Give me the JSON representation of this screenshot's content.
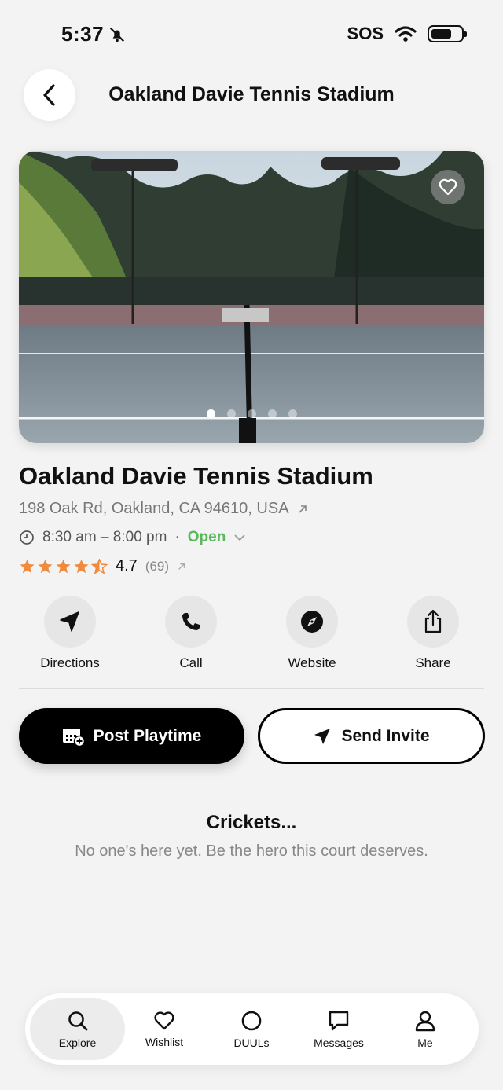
{
  "status_bar": {
    "time": "5:37",
    "carrier": "SOS"
  },
  "header": {
    "title": "Oakland Davie Tennis Stadium"
  },
  "gallery": {
    "page_count": 5,
    "active_index": 0
  },
  "venue": {
    "name": "Oakland Davie Tennis Stadium",
    "address": "198 Oak Rd, Oakland, CA 94610, USA",
    "hours": "8:30 am – 8:00 pm",
    "separator": "·",
    "status": "Open",
    "rating": "4.7",
    "rating_count": "(69)",
    "stars": 4.5
  },
  "actions": [
    {
      "label": "Directions",
      "icon": "navigation-arrow-icon"
    },
    {
      "label": "Call",
      "icon": "phone-icon"
    },
    {
      "label": "Website",
      "icon": "compass-icon"
    },
    {
      "label": "Share",
      "icon": "share-icon"
    }
  ],
  "buttons": {
    "post_playtime": "Post Playtime",
    "send_invite": "Send Invite"
  },
  "empty_state": {
    "title": "Crickets...",
    "subtitle": "No one's here yet. Be the hero this court deserves."
  },
  "tabbar": [
    {
      "label": "Explore",
      "icon": "search-icon",
      "active": true
    },
    {
      "label": "Wishlist",
      "icon": "heart-icon",
      "active": false
    },
    {
      "label": "DUULs",
      "icon": "circle-icon",
      "active": false
    },
    {
      "label": "Messages",
      "icon": "message-icon",
      "active": false
    },
    {
      "label": "Me",
      "icon": "person-icon",
      "active": false
    }
  ],
  "colors": {
    "open": "#5cb85c",
    "star": "#f08a3c",
    "background": "#f3f3f3"
  }
}
